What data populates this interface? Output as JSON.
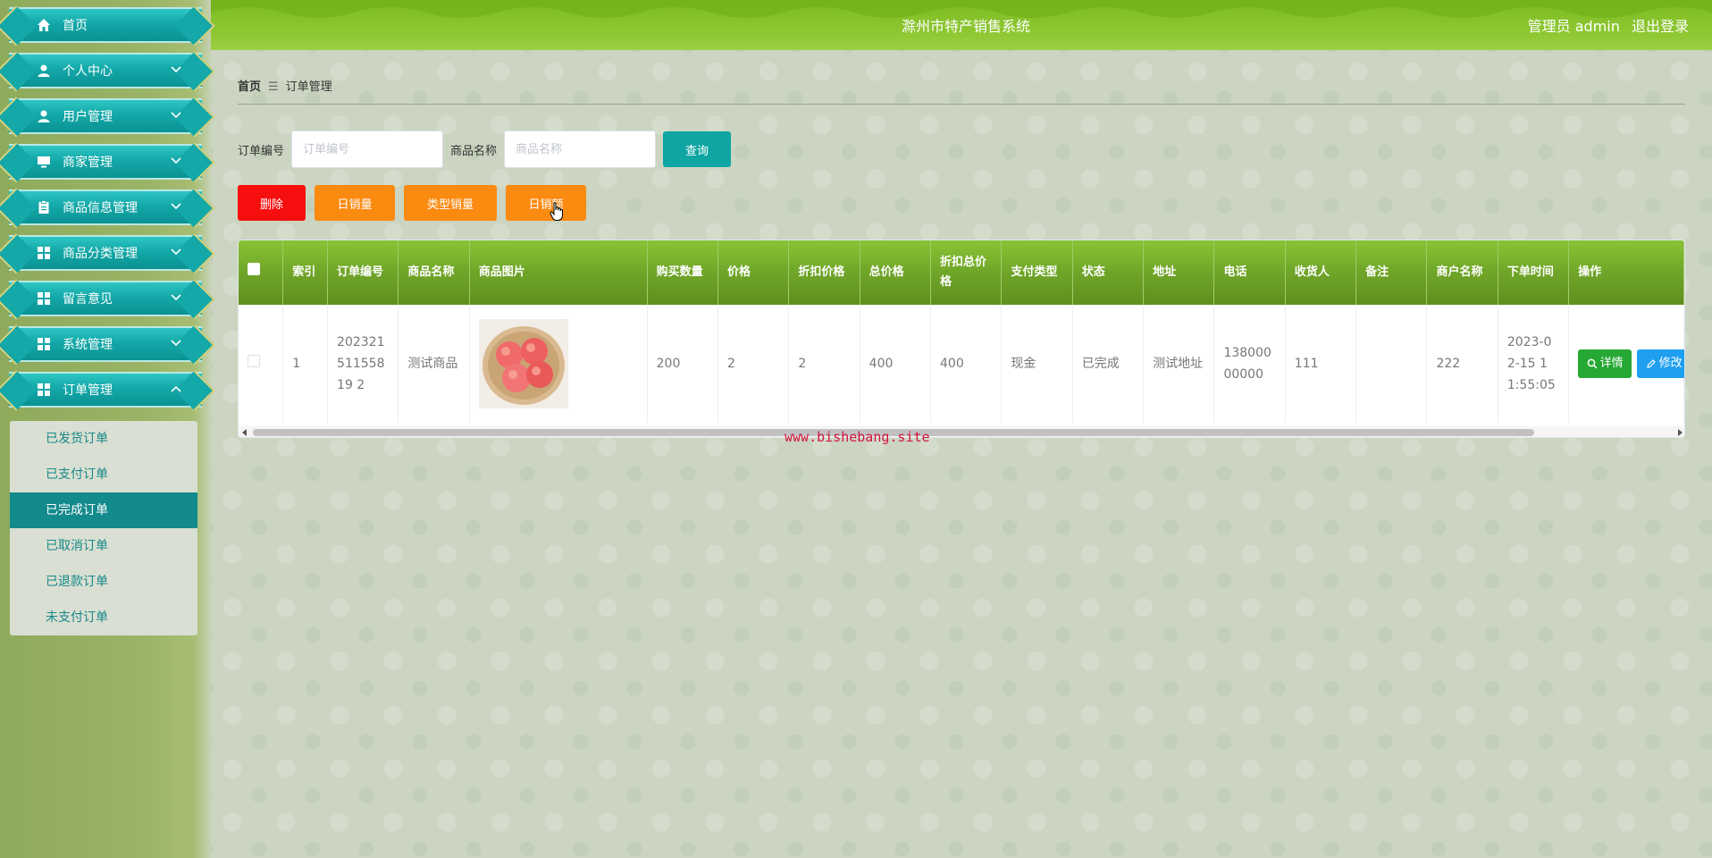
{
  "header": {
    "title": "滁州市特产销售系统",
    "user_role": "管理员 admin",
    "logout": "退出登录"
  },
  "sidebar": {
    "items": [
      {
        "label": "首页",
        "icon": "home-icon"
      },
      {
        "label": "个人中心",
        "icon": "user-icon"
      },
      {
        "label": "用户管理",
        "icon": "user-icon"
      },
      {
        "label": "商家管理",
        "icon": "monitor-icon"
      },
      {
        "label": "商品信息管理",
        "icon": "clipboard-icon"
      },
      {
        "label": "商品分类管理",
        "icon": "grid-icon"
      },
      {
        "label": "留言意见",
        "icon": "grid-icon"
      },
      {
        "label": "系统管理",
        "icon": "grid-icon"
      },
      {
        "label": "订单管理",
        "icon": "grid-icon"
      }
    ],
    "order_submenu": [
      {
        "label": "已发货订单"
      },
      {
        "label": "已支付订单"
      },
      {
        "label": "已完成订单"
      },
      {
        "label": "已取消订单"
      },
      {
        "label": "已退款订单"
      },
      {
        "label": "未支付订单"
      }
    ],
    "active_submenu": "已完成订单"
  },
  "breadcrumb": {
    "home": "首页",
    "separator": "☰",
    "current": "订单管理"
  },
  "search": {
    "order_no_label": "订单编号",
    "order_no_placeholder": "订单编号",
    "product_name_label": "商品名称",
    "product_name_placeholder": "商品名称",
    "query_button": "查询"
  },
  "actions": {
    "delete": "删除",
    "daily_sales": "日销量",
    "type_sales": "类型销量",
    "daily_revenue": "日销额"
  },
  "table": {
    "headers": [
      "索引",
      "订单编号",
      "商品名称",
      "商品图片",
      "购买数量",
      "价格",
      "折扣价格",
      "总价格",
      "折扣总价格",
      "支付类型",
      "状态",
      "地址",
      "电话",
      "收货人",
      "备注",
      "商户名称",
      "下单时间",
      "操作"
    ],
    "rows": [
      {
        "index": "1",
        "order_no": "20232151155819 2",
        "product_name": "测试商品",
        "quantity": "200",
        "price": "2",
        "discount_price": "2",
        "total_price": "400",
        "discount_total": "400",
        "pay_type": "现金",
        "status": "已完成",
        "address": "测试地址",
        "phone": "13800000000",
        "receiver": "111",
        "remark": "",
        "merchant": "222",
        "order_time": "2023-02-15 11:55:05",
        "detail_btn": "详情",
        "edit_btn": "修改"
      }
    ]
  },
  "watermark": "www.bishebang.site",
  "colors": {
    "menu_teal": "#14a8a8",
    "header_green": "#7dbb22",
    "delete_red": "#f70f0f",
    "action_orange": "#fb8a10",
    "query_teal": "#0ea5a2",
    "detail_green": "#26a834",
    "edit_blue": "#1f9ff0"
  }
}
